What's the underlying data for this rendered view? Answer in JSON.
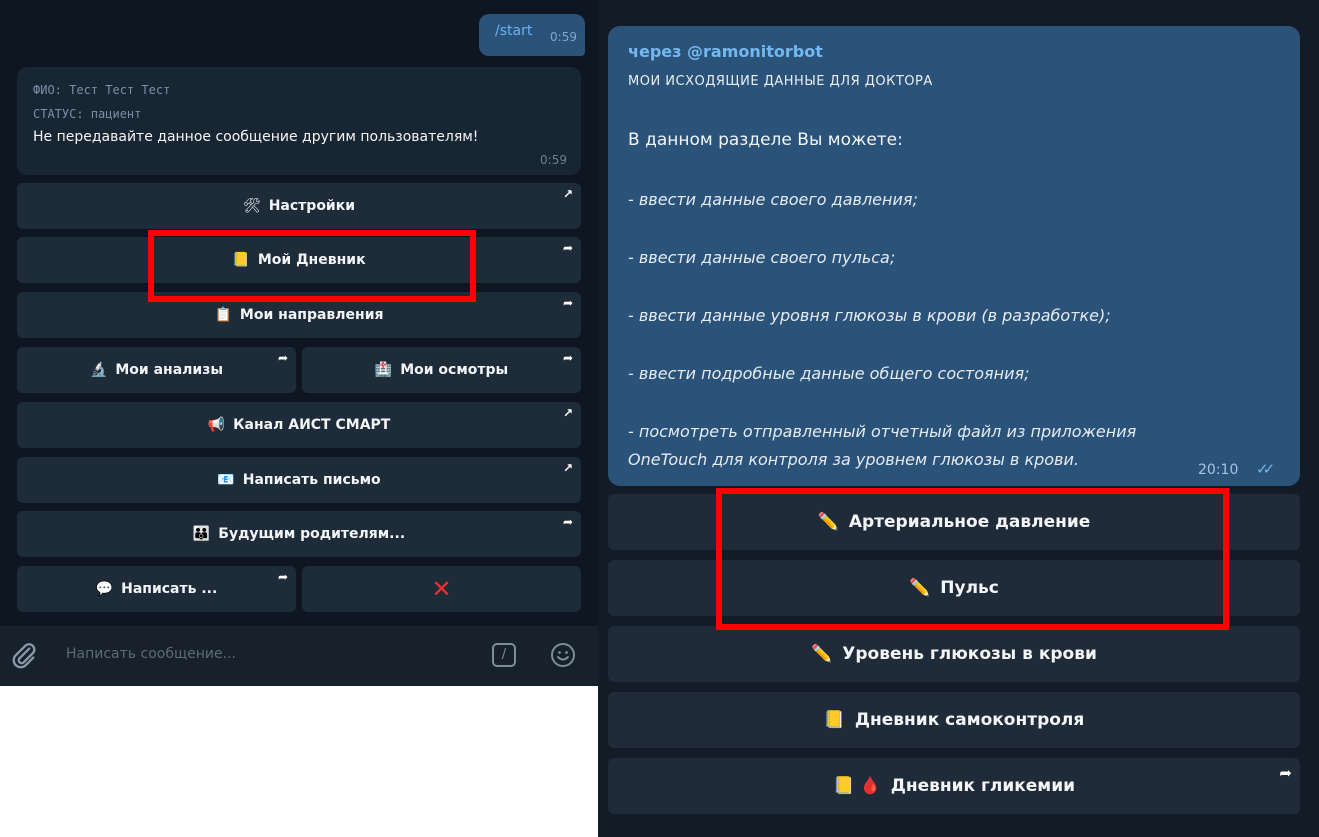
{
  "left": {
    "outgoing": {
      "text": "/start",
      "time": "0:59"
    },
    "incoming": {
      "fio": "ФИО: Тест Тест Тест",
      "status": "СТАТУС: пациент",
      "warning": "Не передавайте данное сообщение другим пользователям!",
      "time": "0:59"
    },
    "buttons": {
      "settings": {
        "icon": "🛠",
        "label": "Настройки"
      },
      "diary": {
        "icon": "📒",
        "label": "Мой Дневник"
      },
      "referrals": {
        "icon": "📋",
        "label": "Мои направления"
      },
      "analyses": {
        "icon": "🔬",
        "label": "Мои анализы"
      },
      "exams": {
        "icon": "🏥",
        "label": "Мои осмотры"
      },
      "channel": {
        "icon": "📢",
        "label": "Канал АИСТ СМАРТ"
      },
      "letter": {
        "icon": "📧",
        "label": "Написать письмо"
      },
      "parents": {
        "icon": "👪",
        "label": "Будущим родителям..."
      },
      "write": {
        "icon": "💬",
        "label": "Написать ..."
      },
      "close": {
        "icon": "✕"
      }
    },
    "composer": {
      "placeholder": "Написать сообщение...",
      "command_glyph": "/"
    }
  },
  "right": {
    "message": {
      "via": "через @ramonitorbot",
      "header": "МОИ ИСХОДЯЩИЕ ДАННЫЕ ДЛЯ ДОКТОРА",
      "intro": "В данном разделе Вы можете:",
      "items": [
        "- ввести данные своего давления;",
        "- ввести данные своего пульса;",
        "- ввести данные уровня глюкозы в крови (в разработке);",
        "- ввести подробные данные общего состояния;",
        "- посмотреть отправленный отчетный файл из приложения",
        "OneTouch для контроля за уровнем глюкозы в крови."
      ],
      "time": "20:10",
      "ticks": "✓✓"
    },
    "buttons": {
      "pressure": {
        "icon": "✏️",
        "label": "Артериальное давление"
      },
      "pulse": {
        "icon": "✏️",
        "label": "Пульс"
      },
      "glucose": {
        "icon": "✏️",
        "label": "Уровень глюкозы в крови"
      },
      "selfcontrol": {
        "icon": "📒",
        "label": "Дневник самоконтроля"
      },
      "glycemia": {
        "icon": "📒 🩸",
        "label": "Дневник гликемии"
      }
    }
  },
  "colors": {
    "chat_bg": "#0e1621",
    "outgoing_bubble": "#2b5278",
    "incoming_bubble": "#182533",
    "keyboard_button": "#1e2c3a",
    "highlight": "#ff0000",
    "link": "#74b8f0"
  },
  "icons": {
    "forward_arrow": "arrow-icon",
    "attach": "paperclip-icon",
    "commands": "slash-command-icon",
    "emoji": "smile-icon",
    "close": "red-x-icon"
  }
}
